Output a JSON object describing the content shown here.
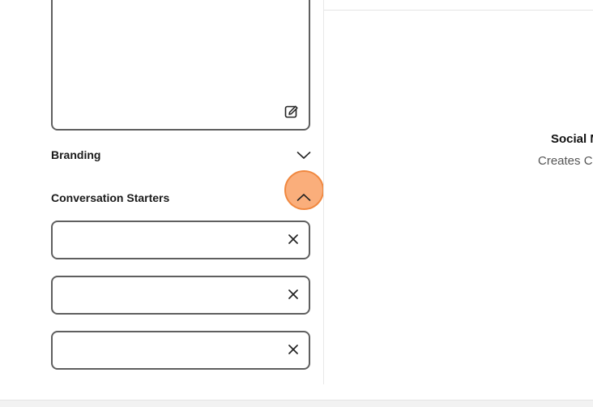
{
  "editor": {
    "edit_icon": "edit-pencil-icon"
  },
  "sections": {
    "branding": {
      "label": "Branding",
      "icon": "chevron-down-icon"
    },
    "conversation_starters": {
      "label": "Conversation Starters",
      "icon": "chevron-up-icon",
      "inputs": [
        {
          "value": "",
          "clear_icon": "close-icon"
        },
        {
          "value": "",
          "clear_icon": "close-icon"
        },
        {
          "value": "",
          "clear_icon": "close-icon"
        }
      ]
    }
  },
  "preview": {
    "title": "Social M",
    "description": "Creates C"
  },
  "colors": {
    "input_border": "#5f5f5f",
    "highlight": "#f9a064"
  }
}
